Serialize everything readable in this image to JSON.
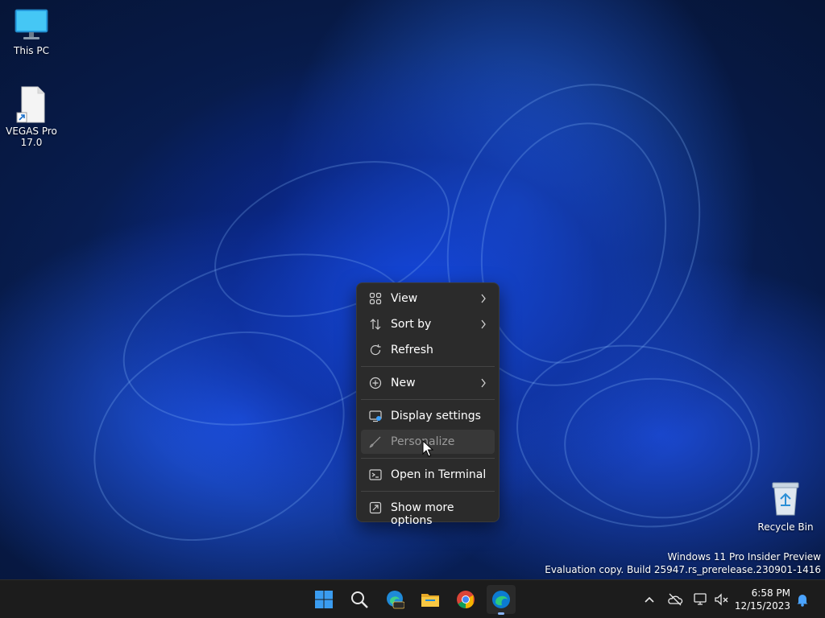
{
  "desktop": {
    "icons": [
      {
        "label": "This PC",
        "icon": "monitor-icon"
      },
      {
        "label": "VEGAS Pro 17.0",
        "icon": "file-shortcut-icon"
      },
      {
        "label": "Recycle Bin",
        "icon": "recycle-bin-icon"
      }
    ],
    "watermark": {
      "line1": "Windows 11 Pro Insider Preview",
      "line2": "Evaluation copy. Build 25947.rs_prerelease.230901-1416"
    }
  },
  "context_menu": {
    "items": [
      {
        "label": "View",
        "icon": "grid-icon",
        "submenu": true
      },
      {
        "label": "Sort by",
        "icon": "sort-icon",
        "submenu": true
      },
      {
        "label": "Refresh",
        "icon": "refresh-icon",
        "submenu": false
      },
      {
        "label": "New",
        "icon": "plus-circle-icon",
        "submenu": true
      },
      {
        "label": "Display settings",
        "icon": "display-settings-icon",
        "submenu": false
      },
      {
        "label": "Personalize",
        "icon": "brush-icon",
        "submenu": false,
        "state": "hovered"
      },
      {
        "label": "Open in Terminal",
        "icon": "terminal-icon",
        "submenu": false
      },
      {
        "label": "Show more options",
        "icon": "open-external-icon",
        "submenu": false
      }
    ]
  },
  "taskbar": {
    "apps": [
      {
        "name": "Start",
        "icon": "windows-start-icon"
      },
      {
        "name": "Search",
        "icon": "search-icon"
      },
      {
        "name": "Microsoft Edge Canary",
        "icon": "edge-pre-icon",
        "badge": "PRE"
      },
      {
        "name": "File Explorer",
        "icon": "folder-icon"
      },
      {
        "name": "Google Chrome",
        "icon": "chrome-icon"
      },
      {
        "name": "Microsoft Edge",
        "icon": "edge-icon",
        "active": true
      }
    ],
    "tray": [
      "chevron-up-icon",
      "onedrive-offline-icon",
      "network-icon",
      "volume-muted-icon",
      "notification-bell-icon"
    ],
    "clock": {
      "time": "6:58 PM",
      "date": "12/15/2023"
    }
  },
  "colors": {
    "menu_bg": "#2b2b2b",
    "menu_hover": "#383838",
    "taskbar_bg": "#1c1c1c",
    "accent_blue": "#0078d4"
  }
}
